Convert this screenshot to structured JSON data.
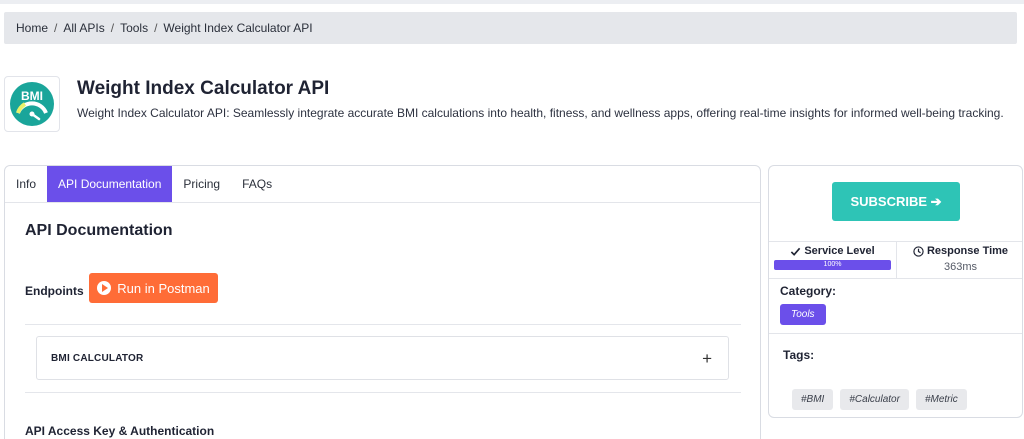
{
  "breadcrumb": {
    "items": [
      "Home",
      "All APIs",
      "Tools",
      "Weight Index Calculator API"
    ],
    "separator": "/"
  },
  "api": {
    "logo_text": "BMI",
    "logo_color": "#1aa59a",
    "title": "Weight Index Calculator API",
    "description": "Weight Index Calculator API: Seamlessly integrate accurate BMI calculations into health, fitness, and wellness apps, offering real-time insights for informed well-being tracking."
  },
  "tabs": [
    {
      "label": "Info",
      "active": false
    },
    {
      "label": "API Documentation",
      "active": true
    },
    {
      "label": "Pricing",
      "active": false
    },
    {
      "label": "FAQs",
      "active": false
    }
  ],
  "doc": {
    "title": "API Documentation",
    "endpoints_label": "Endpoints",
    "postman_label": "Run in Postman",
    "endpoint_name": "BMI CALCULATOR",
    "expand_symbol": "+",
    "auth_title": "API Access Key & Authentication"
  },
  "sidebar": {
    "subscribe_label": "SUBSCRIBE ➔",
    "service_level_label": "Service Level",
    "service_level_value": "100%",
    "service_level_fraction": 1.0,
    "response_time_label": "Response Time",
    "response_time_value": "363ms",
    "category_label": "Category:",
    "category_value": "Tools",
    "tags_label": "Tags:",
    "tags": [
      "#BMI",
      "#Calculator",
      "#Metric"
    ]
  },
  "colors": {
    "accent": "#6b4fea",
    "subscribe": "#2ec4b6",
    "postman": "#ff6c37"
  },
  "icons": {
    "check": "check-icon",
    "clock": "clock-icon",
    "play": "play-circle-icon",
    "plus": "plus-icon"
  }
}
